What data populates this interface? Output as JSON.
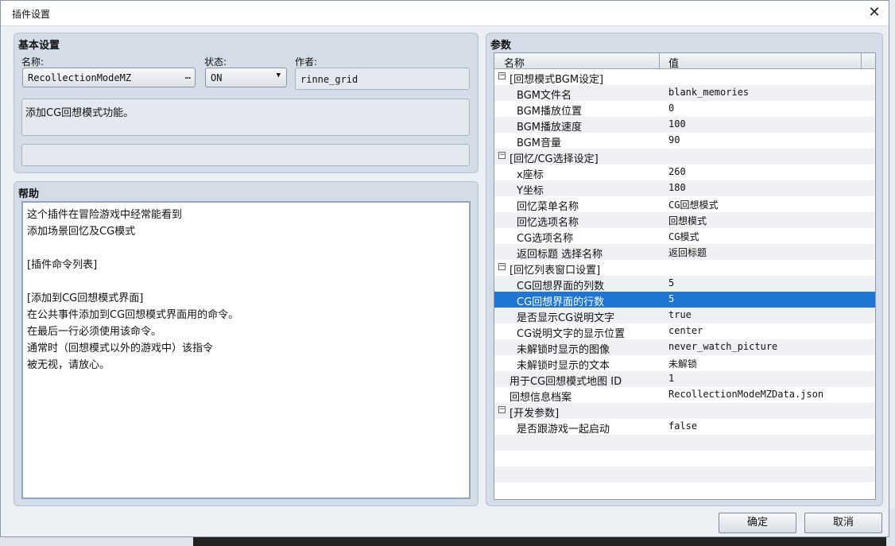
{
  "window": {
    "title": "插件设置",
    "close_glyph": "✕"
  },
  "basic": {
    "header": "基本设置",
    "name_label": "名称:",
    "name_value": "RecollectionModeMZ",
    "name_button": "…",
    "status_label": "状态:",
    "status_value": "ON",
    "status_arrow": "▼",
    "author_label": "作者:",
    "author_value": "rinne_grid",
    "description": "添加CG回想模式功能。",
    "extra": ""
  },
  "help": {
    "header": "帮助",
    "lines": [
      "这个插件在冒险游戏中经常能看到",
      "添加场景回忆及CG模式",
      "",
      "[插件命令列表]",
      "",
      "[添加到CG回想模式界面]",
      "在公共事件添加到CG回想模式界面用的命令。",
      "在最后一行必须使用该命令。",
      "通常时（回想模式以外的游戏中）该指令",
      "被无视，请放心。"
    ]
  },
  "params": {
    "header": "参数",
    "col_name": "名称",
    "col_value": "值",
    "rows": [
      {
        "k": "[回想模式BGM设定]",
        "v": "",
        "group": true,
        "toggle": "−"
      },
      {
        "k": "BGM文件名",
        "v": "blank_memories"
      },
      {
        "k": "BGM播放位置",
        "v": "0"
      },
      {
        "k": "BGM播放速度",
        "v": "100"
      },
      {
        "k": "BGM音量",
        "v": "90"
      },
      {
        "k": "[回忆/CG选择设定]",
        "v": "",
        "group": true,
        "toggle": "−"
      },
      {
        "k": "x座标",
        "v": "260"
      },
      {
        "k": "Y坐标",
        "v": "180"
      },
      {
        "k": "回忆菜单名称",
        "v": "CG回想模式"
      },
      {
        "k": "回忆选项名称",
        "v": "回想模式"
      },
      {
        "k": "CG选项名称",
        "v": "CG模式"
      },
      {
        "k": "返回标题 选择名称",
        "v": "返回标题"
      },
      {
        "k": "[回忆列表窗口设置]",
        "v": "",
        "group": true,
        "toggle": "−"
      },
      {
        "k": "CG回想界面的列数",
        "v": "5"
      },
      {
        "k": "CG回想界面的行数",
        "v": "5",
        "selected": true
      },
      {
        "k": "是否显示CG说明文字",
        "v": "true"
      },
      {
        "k": "CG说明文字的显示位置",
        "v": "center"
      },
      {
        "k": "未解锁时显示的图像",
        "v": "never_watch_picture"
      },
      {
        "k": "未解锁时显示的文本",
        "v": "未解锁"
      },
      {
        "k": "用于CG回想模式地图 ID",
        "v": "1",
        "top": true
      },
      {
        "k": "回想信息档案",
        "v": "RecollectionModeMZData.json",
        "top": true
      },
      {
        "k": "[开发参数]",
        "v": "",
        "group": true,
        "toggle": "−"
      },
      {
        "k": "是否跟游戏一起启动",
        "v": "false"
      },
      {
        "k": "",
        "v": ""
      },
      {
        "k": "",
        "v": ""
      },
      {
        "k": "",
        "v": ""
      },
      {
        "k": "",
        "v": ""
      }
    ]
  },
  "buttons": {
    "ok": "确定",
    "cancel": "取消"
  },
  "colors": {
    "selection": "#1f76d2",
    "panel": "#d3dce7"
  }
}
